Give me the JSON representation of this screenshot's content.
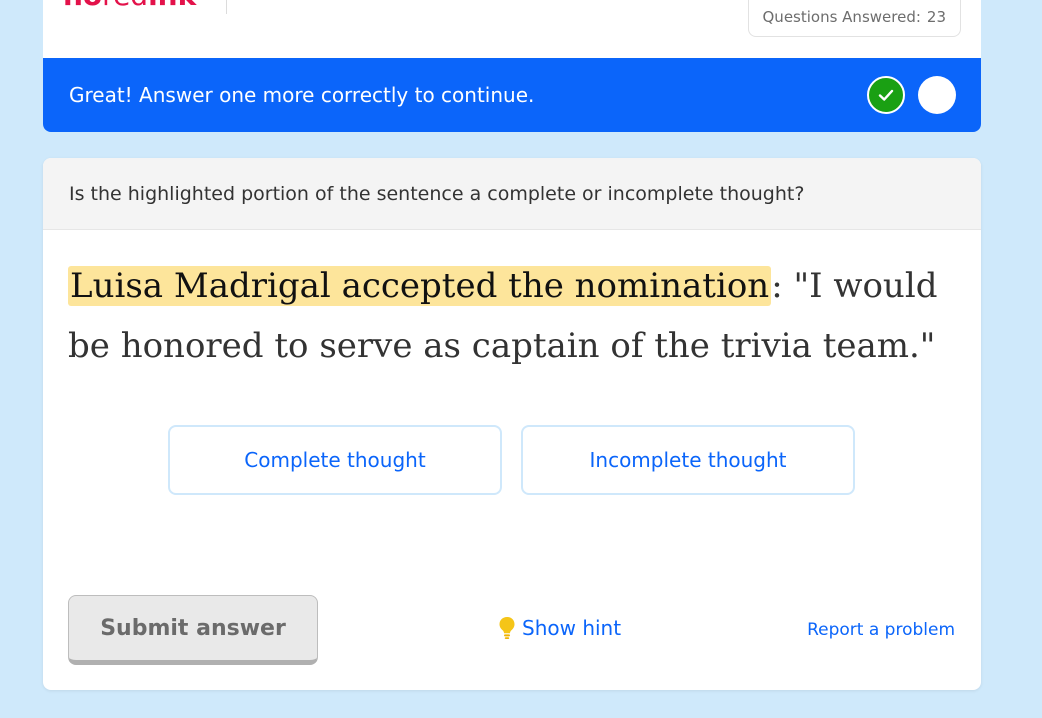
{
  "header": {
    "logo": {
      "part1": "no",
      "part2": "red",
      "part3": "ink"
    },
    "questions_answered": {
      "label": "Questions Answered:",
      "value": "23"
    }
  },
  "banner": {
    "message": "Great! Answer one more correctly to continue.",
    "progress": {
      "completed": 1,
      "total": 2
    },
    "colors": {
      "background": "#0b65fa",
      "done_dot": "#1aa013"
    }
  },
  "question": {
    "prompt": "Is the highlighted portion of the sentence a complete or incomplete thought?",
    "passage": {
      "highlighted": "Luisa Madrigal accepted the nomination",
      "rest": ": \"I would be honored to serve as captain of the trivia team.\""
    },
    "choices": [
      {
        "label": "Complete thought"
      },
      {
        "label": "Incomplete thought"
      }
    ]
  },
  "actions": {
    "submit_label": "Submit answer",
    "hint_label": "Show hint",
    "hint_icon": "lightbulb-icon",
    "report_label": "Report a problem"
  }
}
